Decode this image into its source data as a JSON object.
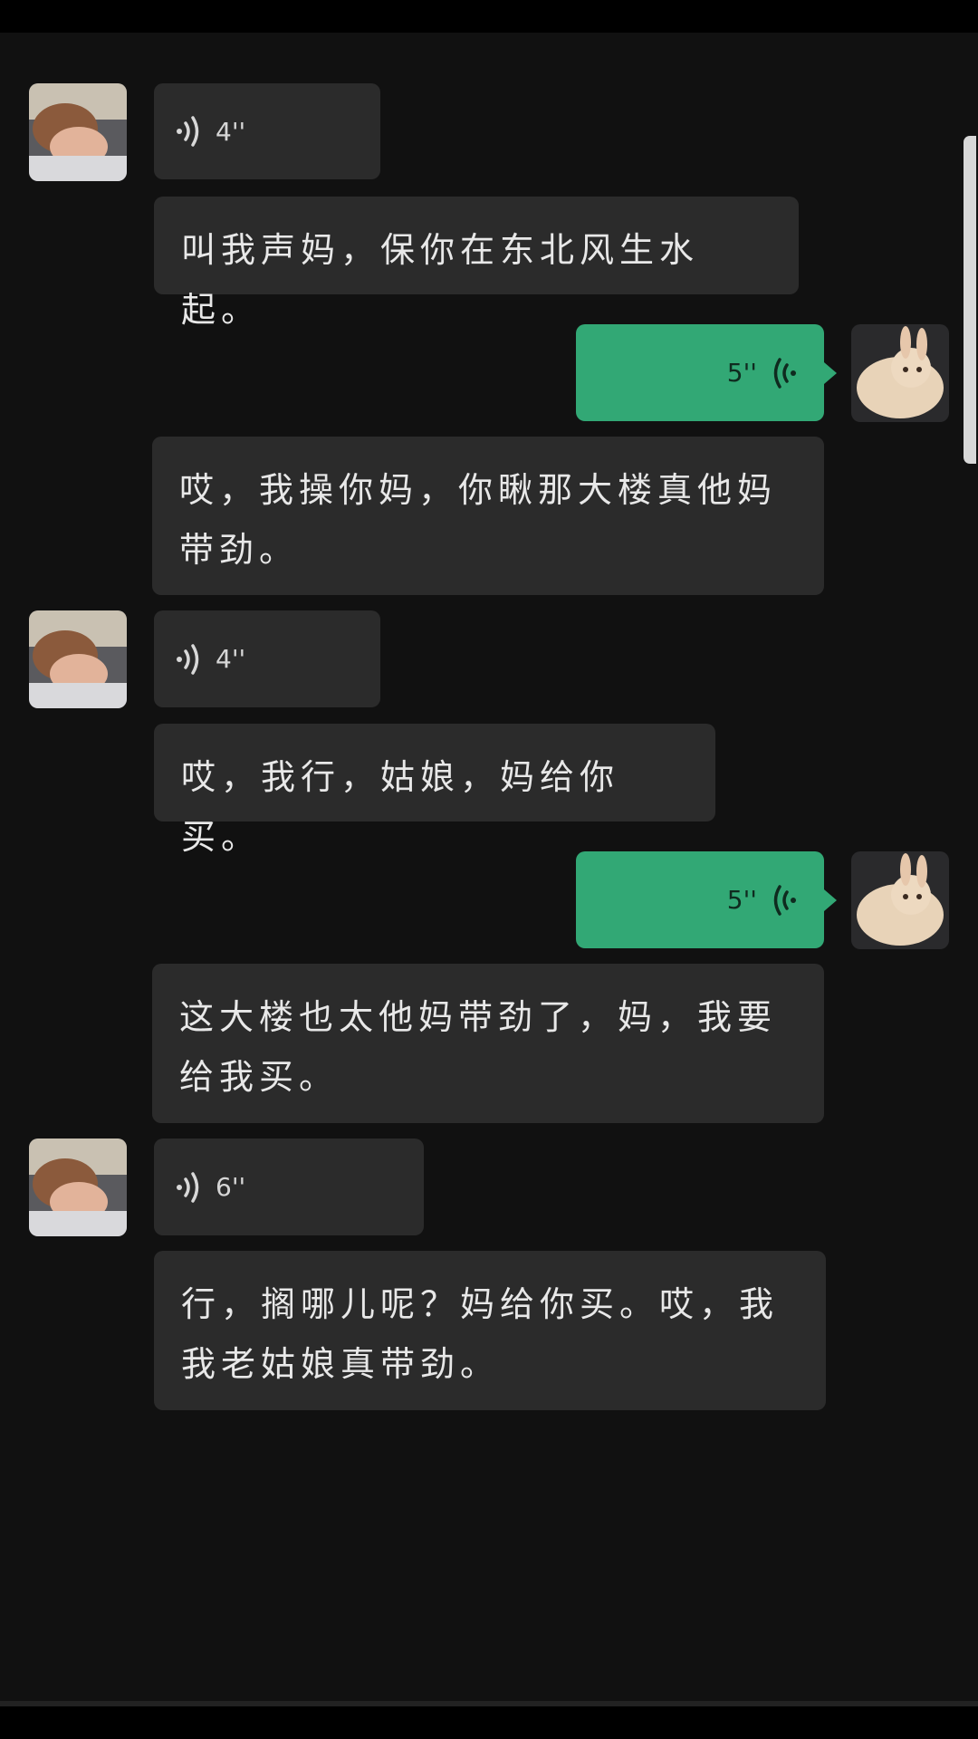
{
  "messages": [
    {
      "type": "voice",
      "side": "in",
      "duration": "4''"
    },
    {
      "type": "text",
      "side": "in",
      "text": "叫我声妈，保你在东北风生水起。"
    },
    {
      "type": "voice",
      "side": "out",
      "duration": "5''"
    },
    {
      "type": "text",
      "side": "in",
      "lines": [
        "哎，我操你妈，你瞅那大楼真他妈",
        "带劲。"
      ]
    },
    {
      "type": "voice",
      "side": "in",
      "duration": "4''"
    },
    {
      "type": "text",
      "side": "in",
      "text": "哎，我行，姑娘，妈给你买。"
    },
    {
      "type": "voice",
      "side": "out",
      "duration": "5''"
    },
    {
      "type": "text",
      "side": "in",
      "lines": [
        "这大楼也太他妈带劲了，妈，我要",
        "给我买。"
      ]
    },
    {
      "type": "voice",
      "side": "in",
      "duration": "6''"
    },
    {
      "type": "text",
      "side": "in",
      "lines": [
        "行，搁哪儿呢？妈给你买。哎，我",
        "我老姑娘真带劲。"
      ]
    }
  ],
  "icons": {
    "incoming_voice": "voice-wave-icon",
    "outgoing_voice": "voice-wave-icon",
    "contact_avatar": "avatar-boy",
    "self_avatar": "avatar-rabbit"
  },
  "colors": {
    "background": "#111111",
    "incoming_bubble": "#2b2b2b",
    "outgoing_bubble": "#32a875"
  }
}
